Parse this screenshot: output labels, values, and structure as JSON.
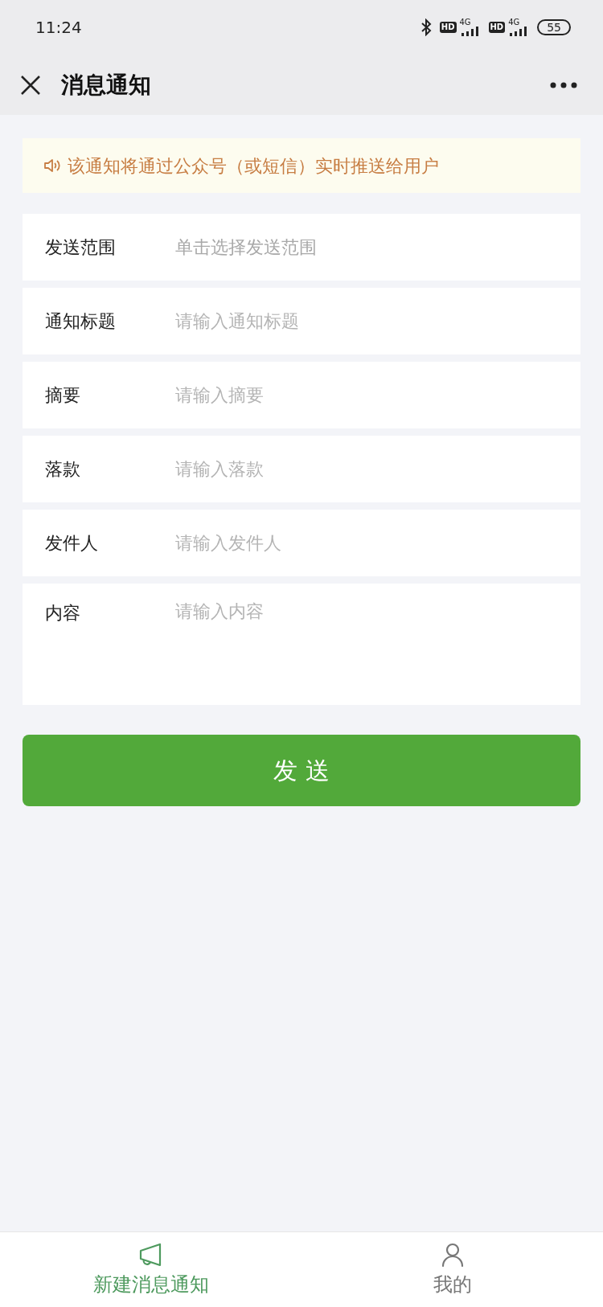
{
  "status_bar": {
    "time": "11:24",
    "signals": [
      {
        "hd": "HD",
        "network": "4G"
      },
      {
        "hd": "HD",
        "network": "4G"
      }
    ],
    "battery": "55"
  },
  "header": {
    "title": "消息通知"
  },
  "notice": {
    "text": "该通知将通过公众号（或短信）实时推送给用户"
  },
  "fields": [
    {
      "label": "发送范围",
      "kind": "picker",
      "placeholder": "单击选择发送范围"
    },
    {
      "label": "通知标题",
      "kind": "input",
      "placeholder": "请输入通知标题"
    },
    {
      "label": "摘要",
      "kind": "input",
      "placeholder": "请输入摘要"
    },
    {
      "label": "落款",
      "kind": "input",
      "placeholder": "请输入落款"
    },
    {
      "label": "发件人",
      "kind": "input",
      "placeholder": "请输入发件人"
    },
    {
      "label": "内容",
      "kind": "textarea",
      "placeholder": "请输入内容"
    }
  ],
  "submit": {
    "label": "发 送"
  },
  "tabs": [
    {
      "label": "新建消息通知",
      "selected": true
    },
    {
      "label": "我的",
      "selected": false
    }
  ]
}
